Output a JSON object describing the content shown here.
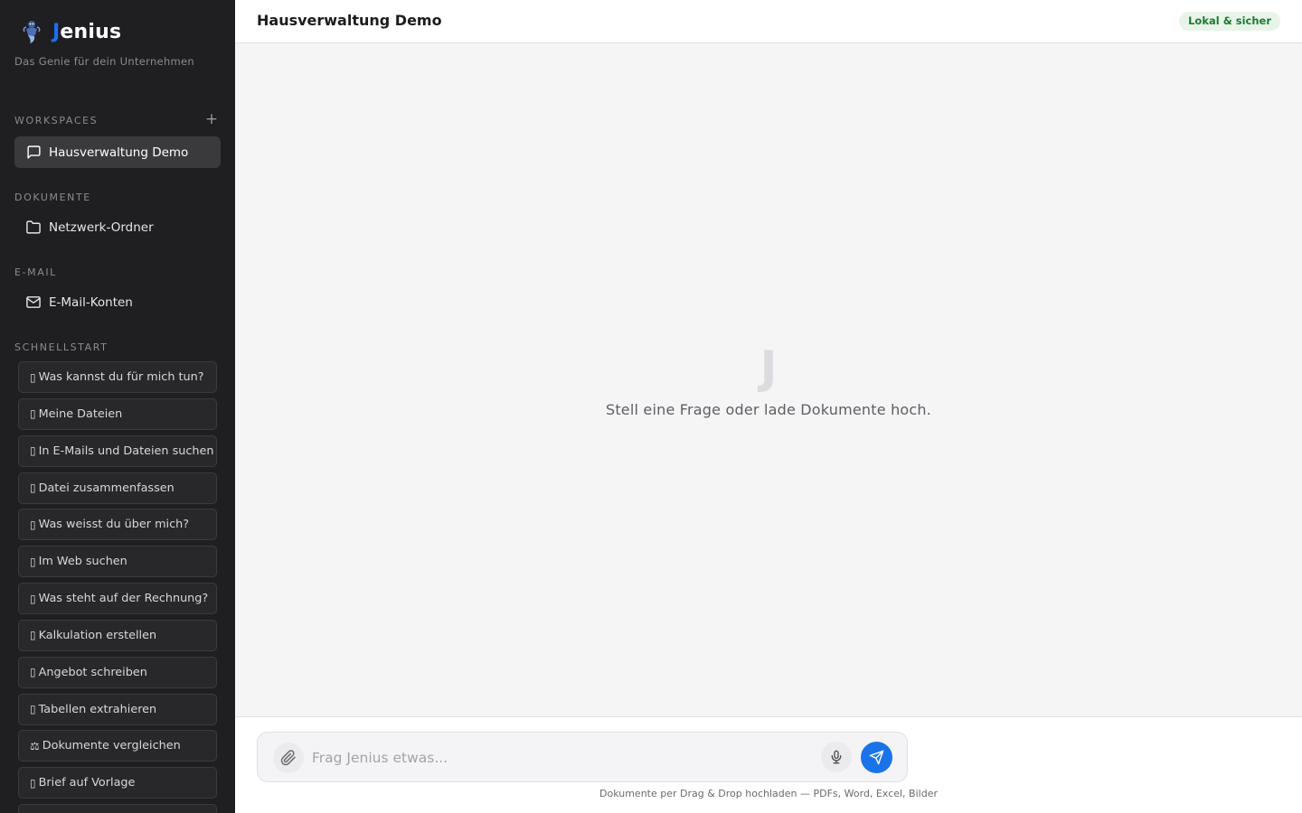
{
  "brand": {
    "name_initial": "J",
    "name_rest": "enius",
    "tagline": "Das Genie für dein Unternehmen"
  },
  "sidebar": {
    "workspaces_label": "WORKSPACES",
    "add_workspace": "+",
    "workspaces": [
      {
        "label": "Hausverwaltung Demo",
        "icon": "chat-bubble-icon",
        "active": true
      }
    ],
    "documents_label": "DOKUMENTE",
    "documents_item": {
      "label": "Netzwerk-Ordner",
      "icon": "folder-icon"
    },
    "email_label": "E-MAIL",
    "email_item": {
      "label": "E-Mail-Konten",
      "icon": "mail-icon"
    },
    "quickstart_label": "SCHNELLSTART",
    "quickstart": [
      {
        "icon": "▯",
        "label": "Was kannst du für mich tun?"
      },
      {
        "icon": "▯",
        "label": "Meine Dateien"
      },
      {
        "icon": "▯",
        "label": "In E-Mails und Dateien suchen"
      },
      {
        "icon": "▯",
        "label": "Datei zusammenfassen"
      },
      {
        "icon": "▯",
        "label": "Was weisst du über mich?"
      },
      {
        "icon": "▯",
        "label": "Im Web suchen"
      },
      {
        "icon": "▯",
        "label": "Was steht auf der Rechnung?"
      },
      {
        "icon": "▯",
        "label": "Kalkulation erstellen"
      },
      {
        "icon": "▯",
        "label": "Angebot schreiben"
      },
      {
        "icon": "▯",
        "label": "Tabellen extrahieren"
      },
      {
        "icon": "⚖",
        "label": "Dokumente vergleichen"
      },
      {
        "icon": "▯",
        "label": "Brief auf Vorlage"
      },
      {
        "icon": "",
        "label": ""
      }
    ]
  },
  "header": {
    "title": "Hausverwaltung Demo",
    "status": "Lokal & sicher"
  },
  "main": {
    "empty_mark": "J",
    "empty_text": "Stell eine Frage oder lade Dokumente hoch."
  },
  "composer": {
    "placeholder": "Frag Jenius etwas...",
    "value": "",
    "hint": "Dokumente per Drag & Drop hochladen — PDFs, Word, Excel, Bilder"
  },
  "colors": {
    "accent": "#1a73e8",
    "brand_blue": "#1e6ef5",
    "sidebar_bg": "#1f1f21",
    "status_green": "#1d7a32"
  }
}
